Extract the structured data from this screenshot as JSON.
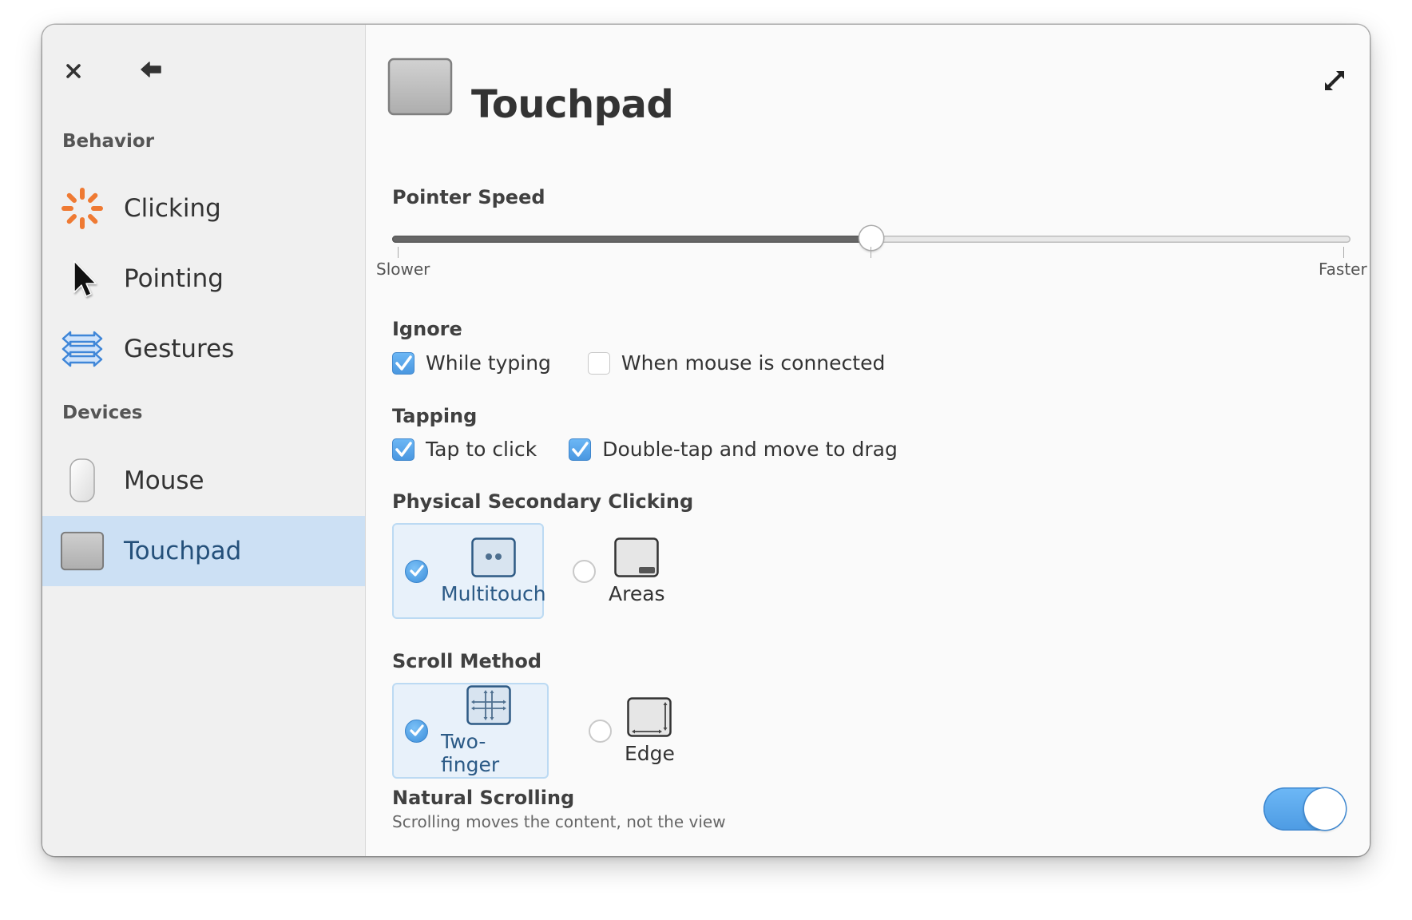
{
  "window": {
    "close_icon": "close-icon",
    "back_icon": "back-arrow-icon",
    "expand_icon": "expand-icon"
  },
  "sidebar": {
    "sections": [
      {
        "label": "Behavior",
        "items": [
          {
            "label": "Clicking",
            "icon": "clicking-icon"
          },
          {
            "label": "Pointing",
            "icon": "pointer-icon"
          },
          {
            "label": "Gestures",
            "icon": "gestures-icon"
          }
        ]
      },
      {
        "label": "Devices",
        "items": [
          {
            "label": "Mouse",
            "icon": "mouse-icon"
          },
          {
            "label": "Touchpad",
            "icon": "touchpad-icon",
            "active": true
          }
        ]
      }
    ]
  },
  "page": {
    "title": "Touchpad",
    "icon": "touchpad-icon"
  },
  "pointer_speed": {
    "label": "Pointer Speed",
    "value": 0.5,
    "min_label": "Slower",
    "max_label": "Faster"
  },
  "ignore": {
    "label": "Ignore",
    "options": [
      {
        "label": "While typing",
        "checked": true
      },
      {
        "label": "When mouse is connected",
        "checked": false
      }
    ]
  },
  "tapping": {
    "label": "Tapping",
    "options": [
      {
        "label": "Tap to click",
        "checked": true
      },
      {
        "label": "Double-tap and move to drag",
        "checked": true
      }
    ]
  },
  "secondary_click": {
    "label": "Physical Secondary Clicking",
    "options": [
      {
        "label": "Multitouch",
        "selected": true
      },
      {
        "label": "Areas",
        "selected": false
      }
    ]
  },
  "scroll_method": {
    "label": "Scroll Method",
    "options": [
      {
        "label": "Two-finger",
        "selected": true
      },
      {
        "label": "Edge",
        "selected": false
      }
    ]
  },
  "natural_scrolling": {
    "label": "Natural Scrolling",
    "description": "Scrolling moves the content, not the view",
    "enabled": true
  },
  "colors": {
    "accent": "#4a97e0",
    "selected_row": "#cce0f4",
    "selected_card": "#e8f1fa",
    "clicking_icon": "#ef7a33",
    "gestures_icon": "#4a90e2"
  }
}
